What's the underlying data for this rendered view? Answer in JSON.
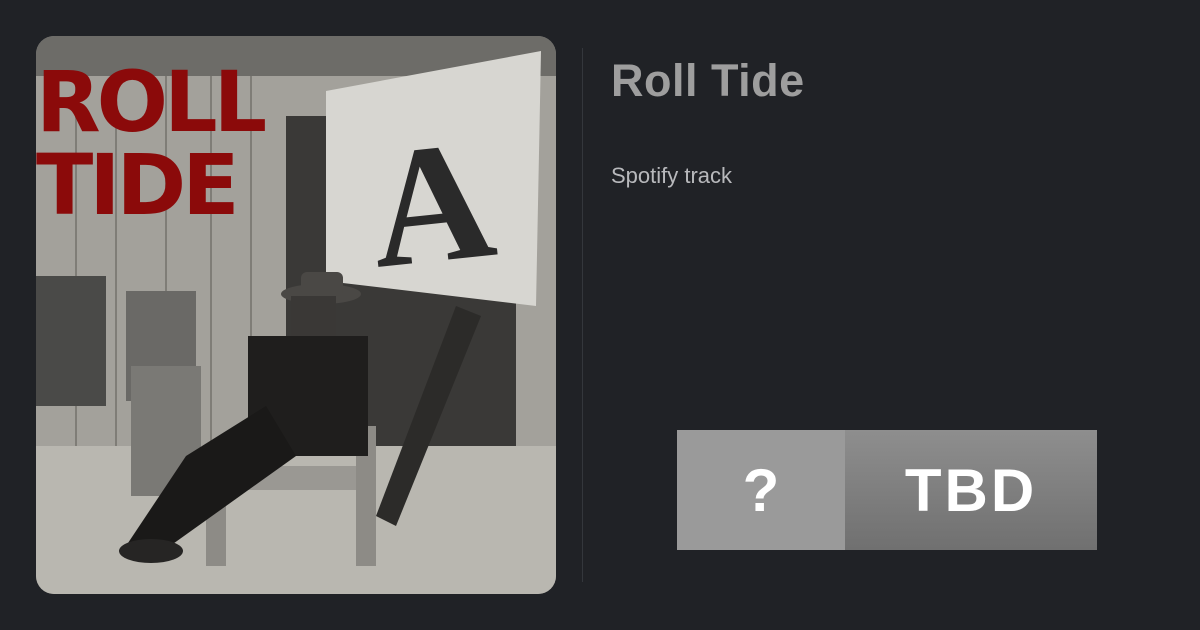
{
  "track": {
    "title": "Roll Tide",
    "subtitle": "Spotify track"
  },
  "cover_art": {
    "lettering_line1": "ROLL",
    "lettering_line2": "TIDE",
    "sign_letter": "A",
    "lettering_color": "#8b0a0a"
  },
  "rating_badge": {
    "symbol": "?",
    "label": "TBD"
  },
  "colors": {
    "background": "#202226",
    "title": "#9e9e9e",
    "subtitle": "#b8b9bc"
  }
}
